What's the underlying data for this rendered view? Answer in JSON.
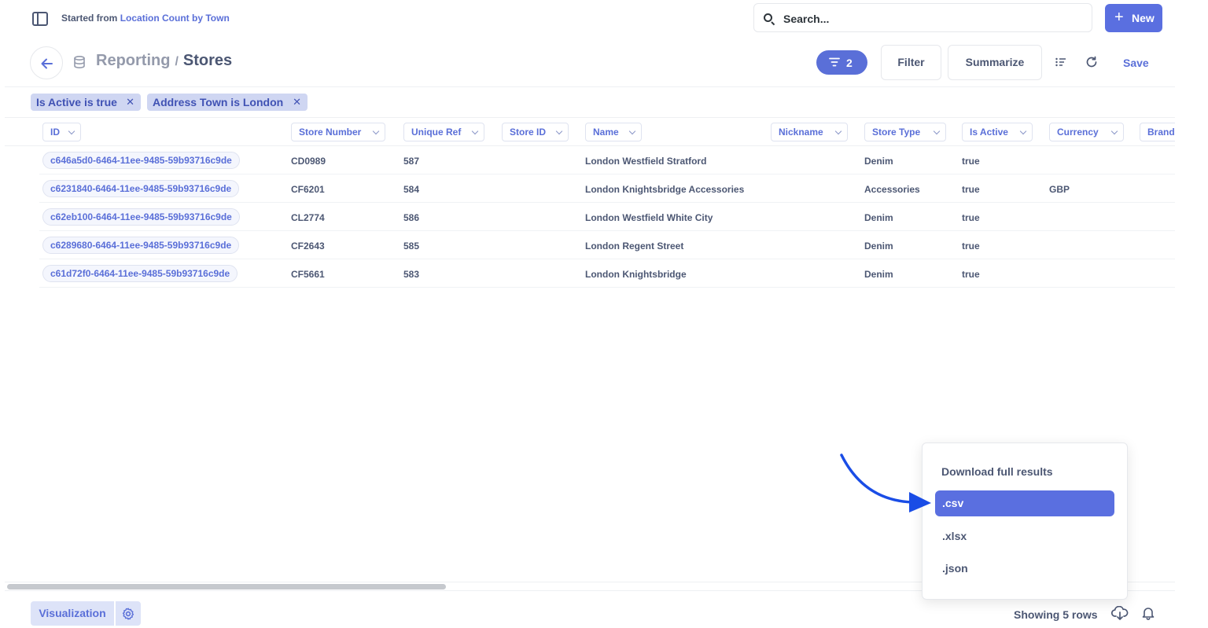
{
  "topbar": {
    "started_prefix": "Started from",
    "started_link": "Location Count by Town",
    "search_placeholder": "Search...",
    "new_label": "New"
  },
  "header": {
    "breadcrumb_parent": "Reporting",
    "breadcrumb_sep": "/",
    "breadcrumb_current": "Stores",
    "filter_count": "2",
    "filter_label": "Filter",
    "summarize_label": "Summarize",
    "save_label": "Save"
  },
  "filters": [
    {
      "label": "Is Active is true"
    },
    {
      "label": "Address Town is London"
    }
  ],
  "table": {
    "columns": [
      "ID",
      "Store Number",
      "Unique Ref",
      "Store ID",
      "Name",
      "Nickname",
      "Store Type",
      "Is Active",
      "Currency",
      "Brand"
    ],
    "rows": [
      {
        "id": "c646a5d0-6464-11ee-9485-59b93716c9de",
        "store_number": "CD0989",
        "unique_ref": "587",
        "store_id": "",
        "name": "London Westfield Stratford",
        "nickname": "",
        "store_type": "Denim",
        "is_active": "true",
        "currency": "",
        "brand": ""
      },
      {
        "id": "c6231840-6464-11ee-9485-59b93716c9de",
        "store_number": "CF6201",
        "unique_ref": "584",
        "store_id": "",
        "name": "London Knightsbridge Accessories",
        "nickname": "",
        "store_type": "Accessories",
        "is_active": "true",
        "currency": "GBP",
        "brand": ""
      },
      {
        "id": "c62eb100-6464-11ee-9485-59b93716c9de",
        "store_number": "CL2774",
        "unique_ref": "586",
        "store_id": "",
        "name": "London Westfield White City",
        "nickname": "",
        "store_type": "Denim",
        "is_active": "true",
        "currency": "",
        "brand": ""
      },
      {
        "id": "c6289680-6464-11ee-9485-59b93716c9de",
        "store_number": "CF2643",
        "unique_ref": "585",
        "store_id": "",
        "name": "London Regent Street",
        "nickname": "",
        "store_type": "Denim",
        "is_active": "true",
        "currency": "",
        "brand": ""
      },
      {
        "id": "c61d72f0-6464-11ee-9485-59b93716c9de",
        "store_number": "CF5661",
        "unique_ref": "583",
        "store_id": "",
        "name": "London Knightsbridge",
        "nickname": "",
        "store_type": "Denim",
        "is_active": "true",
        "currency": "",
        "brand": ""
      }
    ]
  },
  "footer": {
    "visualization_label": "Visualization",
    "rows_label": "Showing 5 rows"
  },
  "download_menu": {
    "title": "Download full results",
    "options": [
      ".csv",
      ".xlsx",
      ".json"
    ],
    "selected": ".csv"
  },
  "colors": {
    "brand": "#5a6fe0",
    "annotation_arrow": "#1a4de6"
  },
  "icons": [
    "sidebar-toggle-icon",
    "search-icon",
    "plus-icon",
    "back-arrow-icon",
    "database-icon",
    "filter-icon",
    "list-icon",
    "refresh-icon",
    "gear-icon",
    "download-icon",
    "bell-icon"
  ]
}
